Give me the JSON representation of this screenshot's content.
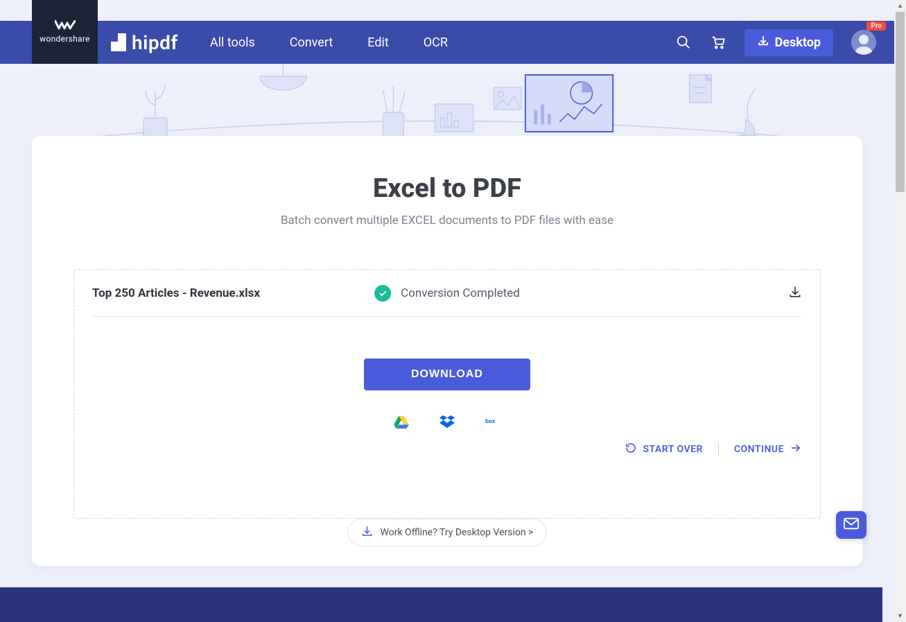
{
  "brand": {
    "company": "wondershare",
    "product": "hipdf"
  },
  "nav": {
    "all_tools": "All tools",
    "convert": "Convert",
    "edit": "Edit",
    "ocr": "OCR"
  },
  "header": {
    "desktop_label": "Desktop",
    "pro_badge": "Pro"
  },
  "page": {
    "title": "Excel to PDF",
    "subtitle": "Batch convert multiple EXCEL documents to PDF files with ease"
  },
  "file": {
    "name": "Top 250 Articles - Revenue.xlsx",
    "status": "Conversion Completed"
  },
  "buttons": {
    "download": "DOWNLOAD",
    "start_over": "START OVER",
    "continue": "CONTINUE"
  },
  "offline": {
    "label": "Work Offline? Try Desktop Version >"
  },
  "cloud": {
    "drive": "google-drive",
    "dropbox": "dropbox",
    "box": "box"
  }
}
